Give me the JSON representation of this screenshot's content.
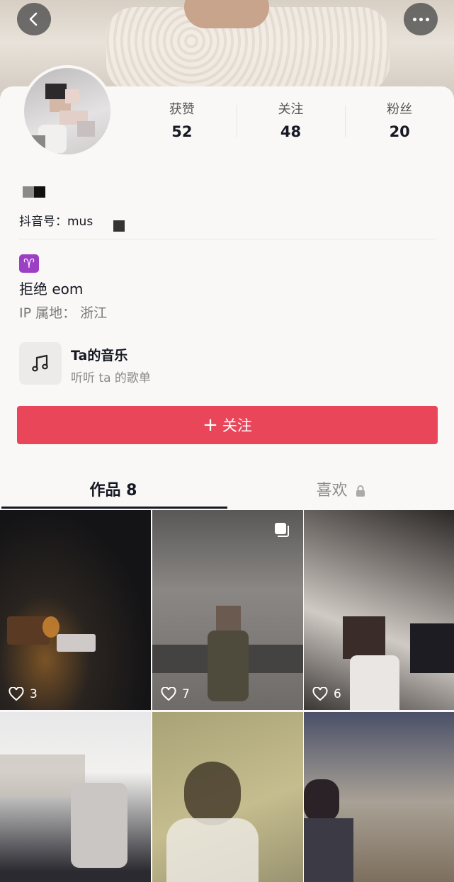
{
  "stats": [
    {
      "label": "获赞",
      "value": "52"
    },
    {
      "label": "关注",
      "value": "48"
    },
    {
      "label": "粉丝",
      "value": "20"
    }
  ],
  "profile": {
    "handle": "抖音号：mus",
    "zodiac": "♈",
    "bio": "拒绝 eom",
    "ip": "IP 属地：  浙江"
  },
  "music": {
    "title": "Ta的音乐",
    "subtitle": "听听 ta 的歌单"
  },
  "follow_button": {
    "plus": "+",
    "label": "关注"
  },
  "tabs": {
    "works": "作品 8",
    "likes": "喜欢"
  },
  "posts": [
    {
      "likes": "3"
    },
    {
      "likes": "7",
      "multi": true
    },
    {
      "likes": "6"
    },
    {},
    {},
    {}
  ],
  "colors": {
    "accent": "#e9465a",
    "zodiac_badge": "#9b3fc5"
  }
}
